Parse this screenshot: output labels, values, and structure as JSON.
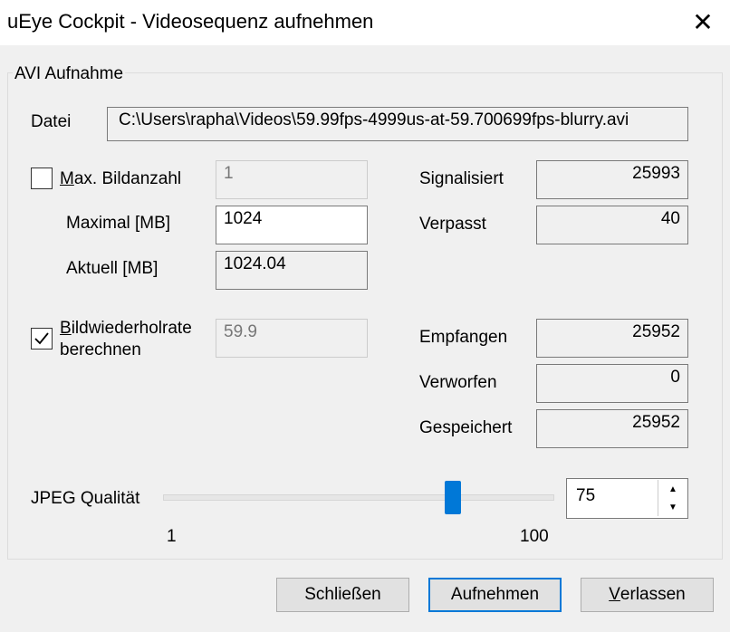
{
  "window": {
    "title": "uEye Cockpit - Videosequenz aufnehmen",
    "close_glyph": "✕"
  },
  "group": {
    "label": "AVI Aufnahme"
  },
  "file": {
    "label": "Datei",
    "value": "C:\\Users\\rapha\\Videos\\59.99fps-4999us-at-59.700699fps-blurry.avi"
  },
  "max_frames": {
    "label_prefix": "M",
    "label_rest": "ax. Bildanzahl",
    "checked": false,
    "value": "1"
  },
  "max_mb": {
    "label": "Maximal [MB]",
    "value": "1024"
  },
  "current_mb": {
    "label": "Aktuell [MB]",
    "value": "1024.04"
  },
  "framerate": {
    "label_prefix": "B",
    "label_line1_rest": "ildwiederholrate",
    "label_line2": "berechnen",
    "checked": true,
    "value": "59.9"
  },
  "stats": {
    "signalisiert": {
      "label": "Signalisiert",
      "value": "25993"
    },
    "verpasst": {
      "label": "Verpasst",
      "value": "40"
    },
    "empfangen": {
      "label": "Empfangen",
      "value": "25952"
    },
    "verworfen": {
      "label": "Verworfen",
      "value": "0"
    },
    "gespeichert": {
      "label": "Gespeichert",
      "value": "25952"
    }
  },
  "jpeg": {
    "label": "JPEG Qualität",
    "min_label": "1",
    "max_label": "100",
    "value": "75",
    "min": 1,
    "max": 100,
    "slider_value": 75
  },
  "buttons": {
    "close": "Schließen",
    "record": "Aufnehmen",
    "exit_prefix": "V",
    "exit_rest": "erlassen"
  },
  "colors": {
    "accent": "#0078d7",
    "dialog_bg": "#f0f0f0"
  },
  "icons": {
    "close": "close-icon",
    "check": "checkmark-icon",
    "up": "arrow-up-icon",
    "down": "arrow-down-icon"
  }
}
